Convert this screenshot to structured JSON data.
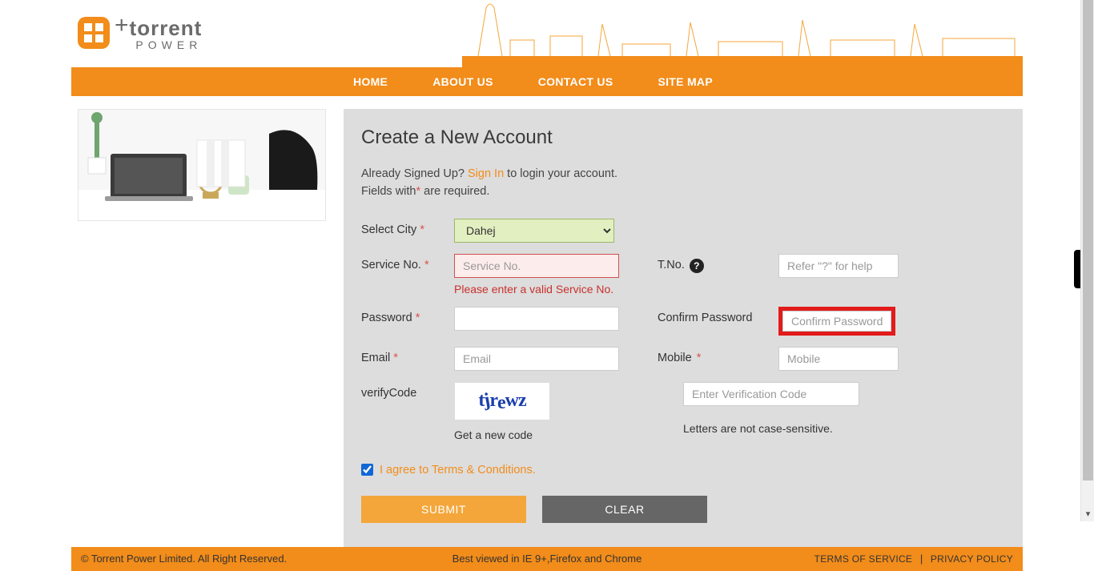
{
  "brand": {
    "name": "torrent",
    "sub": "POWER"
  },
  "nav": {
    "home": "HOME",
    "about": "ABOUT US",
    "contact": "CONTACT US",
    "sitemap": "SITE MAP"
  },
  "page": {
    "title": "Create a New Account",
    "signed_prefix": "Already Signed Up? ",
    "signin": "Sign In",
    "signed_suffix": " to login your account.",
    "required_prefix": "Fields with",
    "required_mark": "*",
    "required_suffix": " are required."
  },
  "labels": {
    "city": "Select City",
    "serviceno": "Service No.",
    "tno": "T.No.",
    "password": "Password",
    "confirm": "Confirm Password",
    "email": "Email",
    "mobile": "Mobile",
    "verify": "verifyCode"
  },
  "fields": {
    "city_value": "Dahej",
    "serviceno_ph": "Service No.",
    "serviceno_error": "Please enter a valid Service No.",
    "tno_ph": "Refer \"?\" for help",
    "confirm_ph": "Confirm Password",
    "email_ph": "Email",
    "mobile_ph": "Mobile",
    "verify_ph": "Enter Verification Code"
  },
  "captcha": {
    "c1": "t",
    "c2": "j",
    "c3": "r",
    "c4": "e",
    "c5": "w",
    "c6": "z",
    "newcode": "Get a new code",
    "note": "Letters are not case-sensitive."
  },
  "terms": {
    "label": "I agree to Terms & Conditions."
  },
  "buttons": {
    "submit": "SUBMIT",
    "clear": "CLEAR"
  },
  "footer": {
    "left": "© Torrent Power Limited. All Right Reserved.",
    "center": "Best viewed in IE 9+,Firefox and Chrome",
    "tos": "TERMS OF SERVICE",
    "privacy": "PRIVACY POLICY"
  }
}
